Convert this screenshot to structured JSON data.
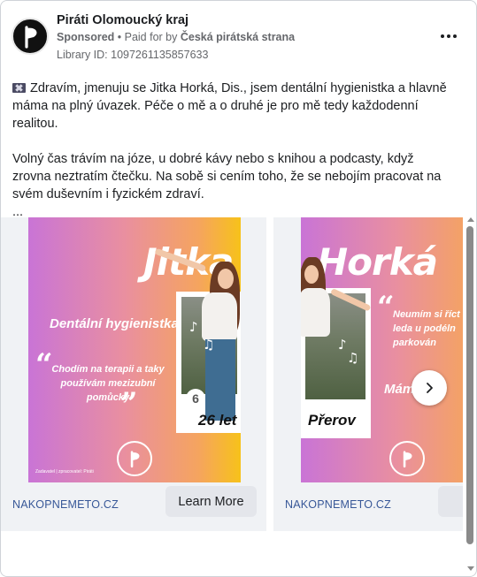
{
  "header": {
    "page_name": "Piráti Olomoucký kraj",
    "sponsored": "Sponsored",
    "paid_for_prefix": " • Paid for by ",
    "paid_for_by": "Česká pirátská strana",
    "library_id": "Library ID: 1097261135857633",
    "avatar_icon": "pirate-party-logo-icon",
    "more_icon": "more-options-icon"
  },
  "body": {
    "paragraph1": "Zdravím, jmenuju se Jitka Horká, Dis., jsem dentální hygienistka a hlavně máma na plný úvazek. Péče o mě a o druhé je pro mě tedy každodenní realitou.",
    "paragraph2": "Volný čas trávím na józe, u dobré kávy nebo s knihou a podcasty, když zrovna neztratím čtečku. Na sobě si cením toho, že se nebojím pracovat na svém duševním i fyzickém zdraví.",
    "ellipsis": "...",
    "flag_icon": "flag-icon"
  },
  "carousel": {
    "cards": [
      {
        "title": "Jitka",
        "tag": "Dentální hygienistka",
        "quote": "Chodím na terapii a  taky\npoužívám mezizubní\npomůcky",
        "badge": "26 let",
        "badge_number": "6",
        "small_print": "Zadavatel | zpracovatel: Piráti",
        "domain": "NAKOPNEMETO.CZ",
        "cta": "Learn More"
      },
      {
        "title": "Horká",
        "tag": "Mám",
        "quote": "Neumím si říct o\nleda u podéln\nparkován",
        "badge": "Přerov",
        "domain": "NAKOPNEMETO.CZ",
        "cta": "Le"
      }
    ],
    "next_icon": "chevron-right-icon"
  },
  "colors": {
    "link": "#385898",
    "gradient_start": "#c974d6",
    "gradient_end": "#f7c21a",
    "button_bg": "#e4e6eb"
  }
}
